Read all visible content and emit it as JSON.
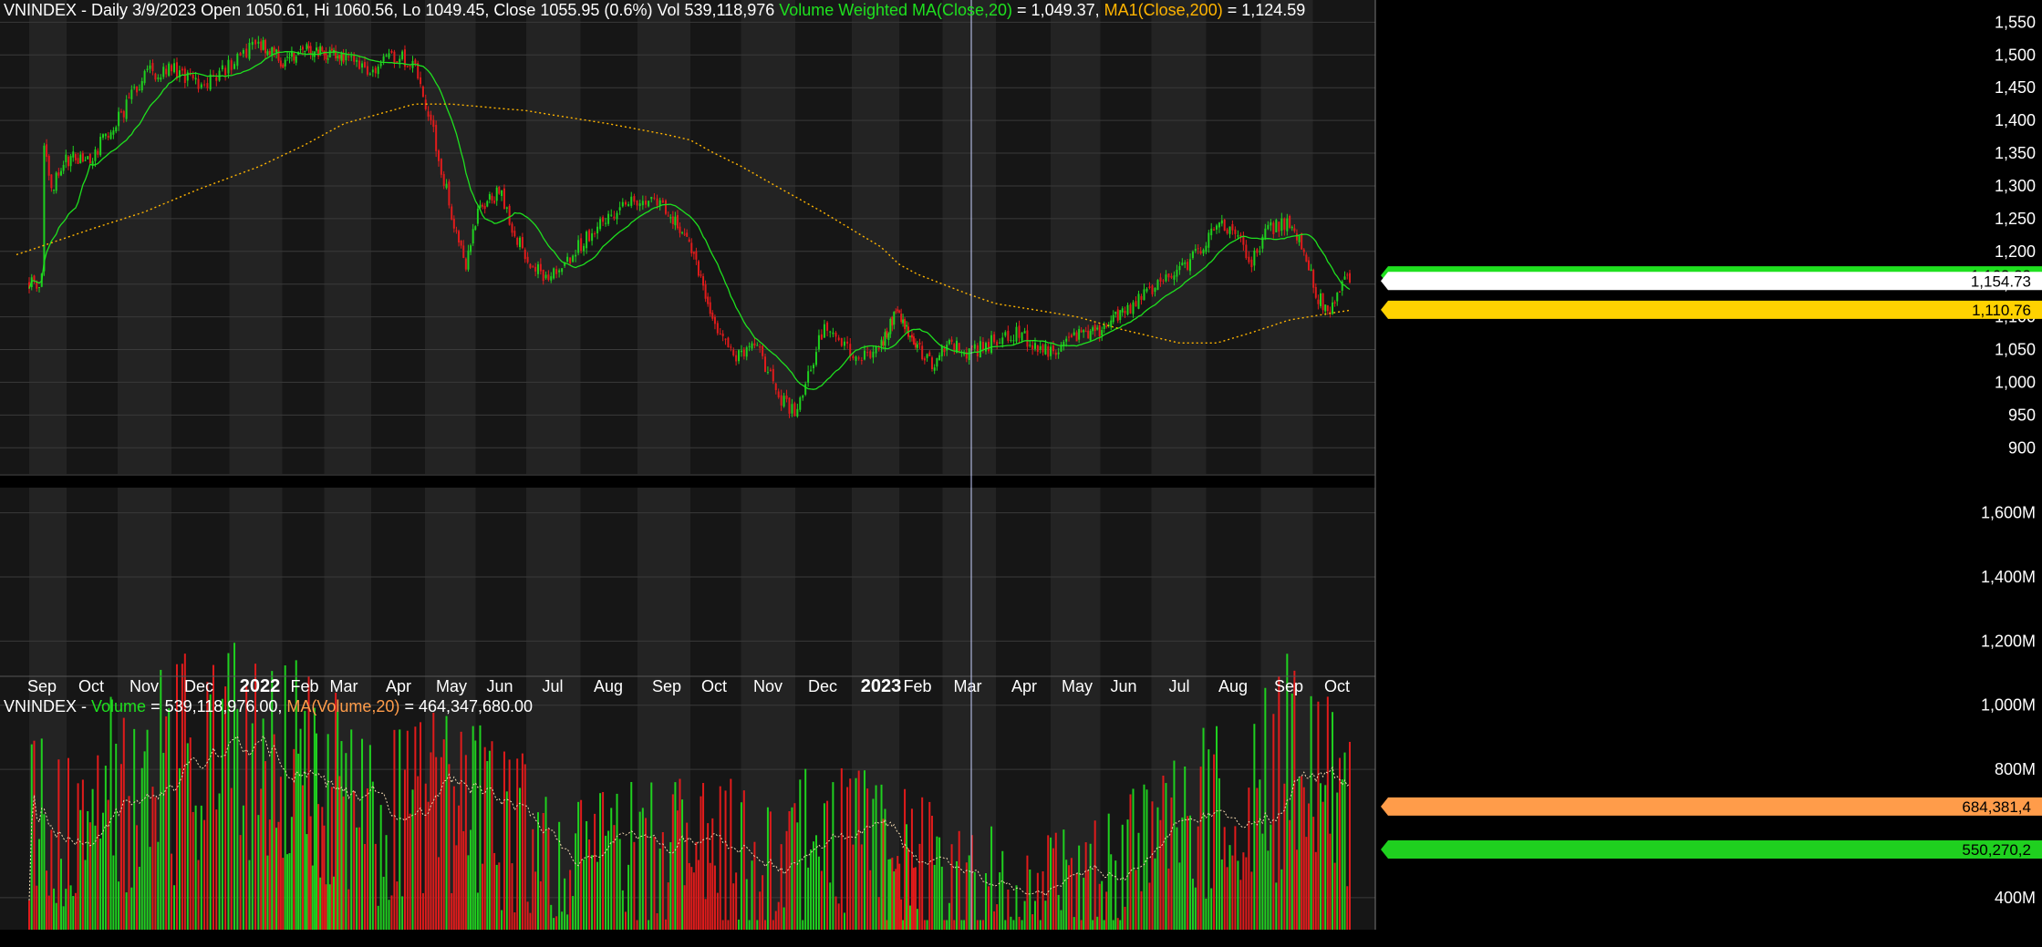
{
  "price_header": {
    "symbol": "VNINDEX",
    "ohlc_text": " - Daily 3/9/2023 Open 1050.61, Hi 1060.56, Lo 1049.45, Close 1055.95 (0.6%) Vol 539,118,976 ",
    "vwma_label": "Volume Weighted MA(Close,20)",
    "vwma_value": " = 1,049.37, ",
    "ma_label": "MA1(Close,200)",
    "ma_value": " = 1,124.59"
  },
  "volume_header": {
    "symbol": "VNINDEX",
    "sep": " - ",
    "vol_label": "Volume",
    "vol_value": " = 539,118,976.00, ",
    "ma_label": "MA(Volume,20)",
    "ma_value": " = 464,347,680.00"
  },
  "colors": {
    "background": "#000000",
    "panel": "#161616",
    "band": "#232323",
    "grid": "#3a3a3a",
    "up": "#1fd01f",
    "down": "#e01b1b",
    "vwma": "#1fe01f",
    "ma200": "#ffb400",
    "vol_ma": "#f0d8b0",
    "text": "#ffffff",
    "cursor": "#c8d0ff"
  },
  "chart_data": [
    {
      "type": "candlestick",
      "title": "VNINDEX - Daily",
      "x_months": [
        "Sep",
        "Oct",
        "Nov",
        "Dec",
        "2022",
        "Feb",
        "Mar",
        "Apr",
        "May",
        "Jun",
        "Jul",
        "Aug",
        "Sep",
        "Oct",
        "Nov",
        "Dec",
        "2023",
        "Feb",
        "Mar",
        "Apr",
        "May",
        "Jun",
        "Jul",
        "Aug",
        "Sep",
        "Oct"
      ],
      "y_ticks": [
        "1,550",
        "1,500",
        "1,450",
        "1,400",
        "1,350",
        "1,300",
        "1,250",
        "1,200",
        "1,150",
        "1,100",
        "1,050",
        "1,000",
        "950",
        "900"
      ],
      "ylim": [
        860,
        1570
      ],
      "anchors_month_index_close": [
        [
          0,
          1380
        ],
        [
          0.2,
          1300
        ],
        [
          0.5,
          1340
        ],
        [
          1.0,
          1345
        ],
        [
          1.5,
          1400
        ],
        [
          2.0,
          1470
        ],
        [
          2.5,
          1480
        ],
        [
          3.0,
          1450
        ],
        [
          3.5,
          1485
        ],
        [
          4.0,
          1520
        ],
        [
          4.5,
          1490
        ],
        [
          5.0,
          1510
        ],
        [
          5.5,
          1505
        ],
        [
          6.0,
          1490
        ],
        [
          6.5,
          1480
        ],
        [
          7.0,
          1500
        ],
        [
          7.3,
          1480
        ],
        [
          7.6,
          1400
        ],
        [
          8.0,
          1260
        ],
        [
          8.3,
          1180
        ],
        [
          8.6,
          1270
        ],
        [
          9.0,
          1290
        ],
        [
          9.3,
          1220
        ],
        [
          9.8,
          1160
        ],
        [
          10.2,
          1180
        ],
        [
          10.7,
          1230
        ],
        [
          11.2,
          1270
        ],
        [
          11.6,
          1285
        ],
        [
          12.0,
          1260
        ],
        [
          12.4,
          1220
        ],
        [
          12.8,
          1140
        ],
        [
          13.0,
          1090
        ],
        [
          13.4,
          1040
        ],
        [
          13.8,
          1050
        ],
        [
          14.2,
          980
        ],
        [
          14.5,
          950
        ],
        [
          14.7,
          1000
        ],
        [
          15.0,
          1080
        ],
        [
          15.3,
          1070
        ],
        [
          15.6,
          1030
        ],
        [
          16.0,
          1060
        ],
        [
          16.4,
          1110
        ],
        [
          16.7,
          1080
        ],
        [
          17.0,
          1050
        ],
        [
          17.3,
          1030
        ],
        [
          17.6,
          1065
        ],
        [
          18.0,
          1045
        ],
        [
          18.4,
          1060
        ],
        [
          18.8,
          1075
        ],
        [
          19.2,
          1060
        ],
        [
          19.6,
          1040
        ],
        [
          20.0,
          1070
        ],
        [
          20.4,
          1075
        ],
        [
          20.8,
          1100
        ],
        [
          21.2,
          1120
        ],
        [
          21.6,
          1150
        ],
        [
          22.0,
          1170
        ],
        [
          22.4,
          1200
        ],
        [
          22.7,
          1235
        ],
        [
          23.0,
          1240
        ],
        [
          23.3,
          1180
        ],
        [
          23.6,
          1230
        ],
        [
          24.0,
          1245
        ],
        [
          24.3,
          1210
        ],
        [
          24.6,
          1130
        ],
        [
          24.85,
          1110
        ],
        [
          25.1,
          1150
        ],
        [
          25.25,
          1155
        ]
      ],
      "series": [
        {
          "name": "VNINDEX",
          "last_value": "1,154.73"
        },
        {
          "name": "Volume Weighted MA(Close,20)",
          "last_value": "1,163.23"
        },
        {
          "name": "MA1(Close,200)",
          "last_value": "1,110.76"
        }
      ]
    },
    {
      "type": "bar",
      "title": "VNINDEX - Volume",
      "y_ticks": [
        "1,600M",
        "1,400M",
        "1,200M",
        "1,000M",
        "800M",
        "400M"
      ],
      "ylim": [
        300,
        1650
      ],
      "unit": "M",
      "anchors_month_index_volume": [
        [
          0,
          650
        ],
        [
          2,
          750
        ],
        [
          3,
          820
        ],
        [
          4,
          880
        ],
        [
          5,
          820
        ],
        [
          6,
          700
        ],
        [
          7,
          650
        ],
        [
          8,
          700
        ],
        [
          9,
          640
        ],
        [
          10,
          520
        ],
        [
          11,
          520
        ],
        [
          12,
          540
        ],
        [
          13,
          560
        ],
        [
          14,
          520
        ],
        [
          15,
          600
        ],
        [
          16,
          560
        ],
        [
          17,
          500
        ],
        [
          18,
          450
        ],
        [
          19,
          430
        ],
        [
          20,
          470
        ],
        [
          21,
          540
        ],
        [
          22,
          600
        ],
        [
          23,
          720
        ],
        [
          24,
          830
        ],
        [
          25,
          680
        ]
      ],
      "series": [
        {
          "name": "Volume",
          "last_value": "550,270,..."
        },
        {
          "name": "MA(Volume,20)",
          "last_value": "684,381,4"
        }
      ]
    }
  ],
  "tags": {
    "vwma": "1,163.23",
    "close": "1,154.73",
    "ma200": "1,110.76",
    "vol_ma": "684,381,4",
    "vol": "550,270,2"
  }
}
